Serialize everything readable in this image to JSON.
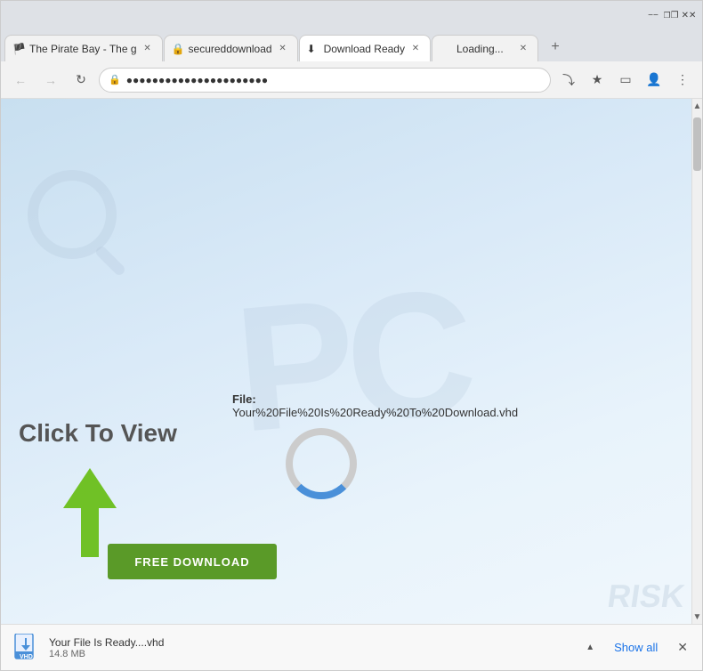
{
  "browser": {
    "tabs": [
      {
        "id": "tab1",
        "label": "The Pirate Bay - The g",
        "active": false,
        "favicon": "🏴"
      },
      {
        "id": "tab2",
        "label": "secureddownload",
        "active": false,
        "favicon": "🔒"
      },
      {
        "id": "tab3",
        "label": "Download Ready",
        "active": true,
        "favicon": "⬇"
      },
      {
        "id": "tab4",
        "label": "Loading...",
        "active": false,
        "favicon": ""
      }
    ],
    "new_tab_label": "+",
    "nav": {
      "back_disabled": true,
      "forward_disabled": true
    },
    "url": "●●●●●●●●●●●●●●●●●●●●●●",
    "toolbar": {
      "share": "⎗",
      "bookmark": "☆",
      "extensions": "⬜",
      "profile": "👤",
      "menu": "⋮"
    }
  },
  "window_controls": {
    "minimize": "—",
    "restore": "❐",
    "close": "✕"
  },
  "page": {
    "watermark_text": "PC",
    "watermark_subtext": "RISK",
    "click_to_view": "Click To View",
    "file_label": "File:",
    "file_name": "Your%20File%20Is%20Ready%20To%20Download.vhd",
    "download_button_label": "FREE DOWNLOAD"
  },
  "download_bar": {
    "file_name": "Your File Is Ready....vhd",
    "file_size": "14.8 MB",
    "show_all_label": "Show all",
    "close_label": "✕"
  },
  "scrollbar": {
    "up": "▲",
    "down": "▼"
  }
}
